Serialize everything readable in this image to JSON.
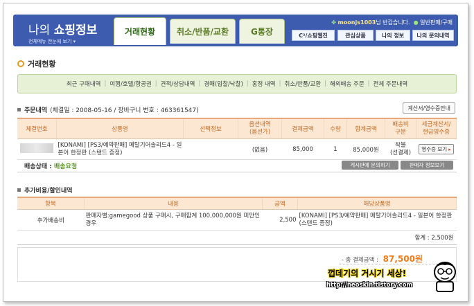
{
  "header": {
    "title_prefix": "나의",
    "title_main": "쇼핑정보",
    "sub_menu": "전체메뉴 한눈에 보기 ▾",
    "tabs": [
      "거래현황",
      "취소/반품/교환",
      "G통장"
    ],
    "user_id": "moonjs1003",
    "greeting": "님 반갑습니다.",
    "member_grade": "일반판매/구매",
    "subnav": [
      "C²/쇼핑웹진",
      "관심상품",
      "나의 정보",
      "나의 문의내역"
    ]
  },
  "page": {
    "section_title": "거래현황",
    "categories": [
      "최근 구매내역",
      "여행/호텔/항공권",
      "견적/상담내역",
      "경매(입찰/낙찰)",
      "홍정 내역",
      "취소/반품/교환",
      "해외배송 주문",
      "전체 주문내역"
    ]
  },
  "order": {
    "block_title": "주문내역",
    "meta": "(체결일 : 2008-05-16 / 장바구니 번호 : 463361547)",
    "receipt_button": "계산서/영수증안내",
    "columns": [
      "체결번호",
      "상품명",
      "선택정보",
      "옵션내역\n(옵션가)",
      "결제금액",
      "수량",
      "합계금액",
      "배송비\n구분",
      "세금계산서/\n현금영수증"
    ],
    "row": {
      "product": "[KONAMI] [PS3/예약판매] 메탈기어솔리드4 - 일본어 한정판 (스탠드 증정)",
      "option": "(없음)",
      "price": "85,000",
      "qty": "1",
      "total": "85,000원",
      "shipping": "착불\n(선결제)",
      "receipt_button": "영수증 보기"
    },
    "ship_status_label": "배송상태 :",
    "ship_status_value": "배송요청",
    "ask_button": "게시판에 문의하기",
    "seller_button": "판매자 정보보기"
  },
  "extra": {
    "block_title": "추가비용/할인내역",
    "columns": [
      "항목",
      "내용",
      "금액",
      "해당상품명"
    ],
    "row": {
      "item": "추가배송비",
      "content": "판매자별:gamegood 상품 구매시, 구매합계 100,000,000원 미만인 경우",
      "amount": "2,500",
      "product": "[KONAMI] [PS3/예약판매] 메탈기어솔리드4 - 일본어 한정판 (스탠드 증정)"
    },
    "sum": "합계 : 2,500원"
  },
  "total": {
    "label": "- 총 결제금액 :",
    "amount": "87,500원"
  },
  "watermark": {
    "title": "껍데기의 거시기 세상!",
    "url": "http://neoskin.tistory.com"
  },
  "colors": {
    "header_blue": "#3d5cb0",
    "accent_orange": "#ee7b19",
    "status_green": "#5a9a22",
    "table_header_bg": "#fbe7d2"
  }
}
